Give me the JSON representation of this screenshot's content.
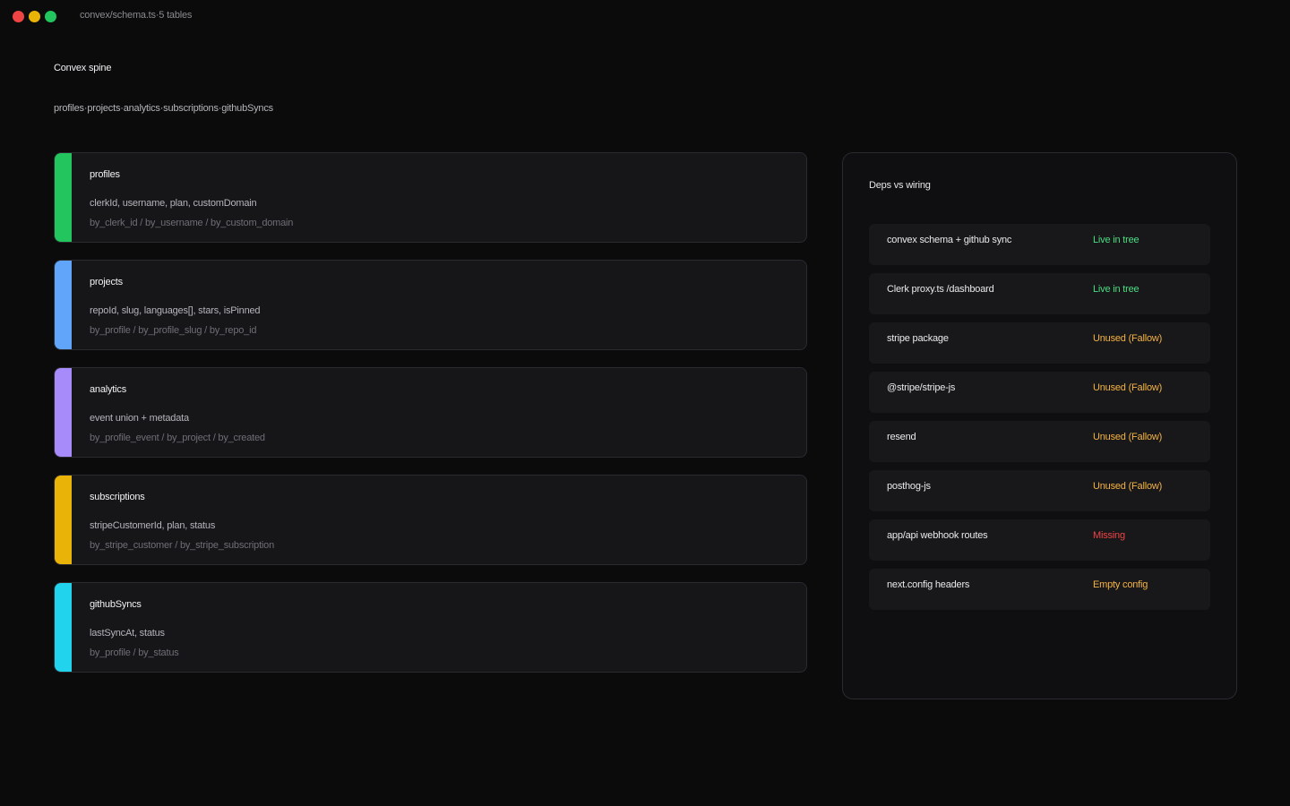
{
  "window": {
    "title": "convex/schema.ts·5 tables"
  },
  "header": {
    "title": "Convex spine",
    "table_list": "profiles·projects·analytics·subscriptions·githubSyncs"
  },
  "tables": [
    {
      "name": "profiles",
      "fields": "clerkId, username, plan, customDomain",
      "indexes": "by_clerk_id / by_username / by_custom_domain",
      "color": "#22c55e"
    },
    {
      "name": "projects",
      "fields": "repoId, slug, languages[], stars, isPinned",
      "indexes": "by_profile / by_profile_slug / by_repo_id",
      "color": "#60a5fa"
    },
    {
      "name": "analytics",
      "fields": "event union + metadata",
      "indexes": "by_profile_event / by_project / by_created",
      "color": "#a78bfa"
    },
    {
      "name": "subscriptions",
      "fields": "stripeCustomerId, plan, status",
      "indexes": "by_stripe_customer / by_stripe_subscription",
      "color": "#eab308"
    },
    {
      "name": "githubSyncs",
      "fields": "lastSyncAt, status",
      "indexes": "by_profile / by_status",
      "color": "#22d3ee"
    }
  ],
  "deps_panel": {
    "title": "Deps vs wiring",
    "rows": [
      {
        "name": "convex schema + github sync",
        "status": "Live in tree",
        "color": "#4ade80"
      },
      {
        "name": "Clerk proxy.ts /dashboard",
        "status": "Live in tree",
        "color": "#4ade80"
      },
      {
        "name": "stripe package",
        "status": "Unused (Fallow)",
        "color": "#f5b342"
      },
      {
        "name": "@stripe/stripe-js",
        "status": "Unused (Fallow)",
        "color": "#f5b342"
      },
      {
        "name": "resend",
        "status": "Unused (Fallow)",
        "color": "#f5b342"
      },
      {
        "name": "posthog-js",
        "status": "Unused (Fallow)",
        "color": "#f5b342"
      },
      {
        "name": "app/api webhook routes",
        "status": "Missing",
        "color": "#ef4444"
      },
      {
        "name": "next.config headers",
        "status": "Empty config",
        "color": "#f5b342"
      }
    ]
  }
}
